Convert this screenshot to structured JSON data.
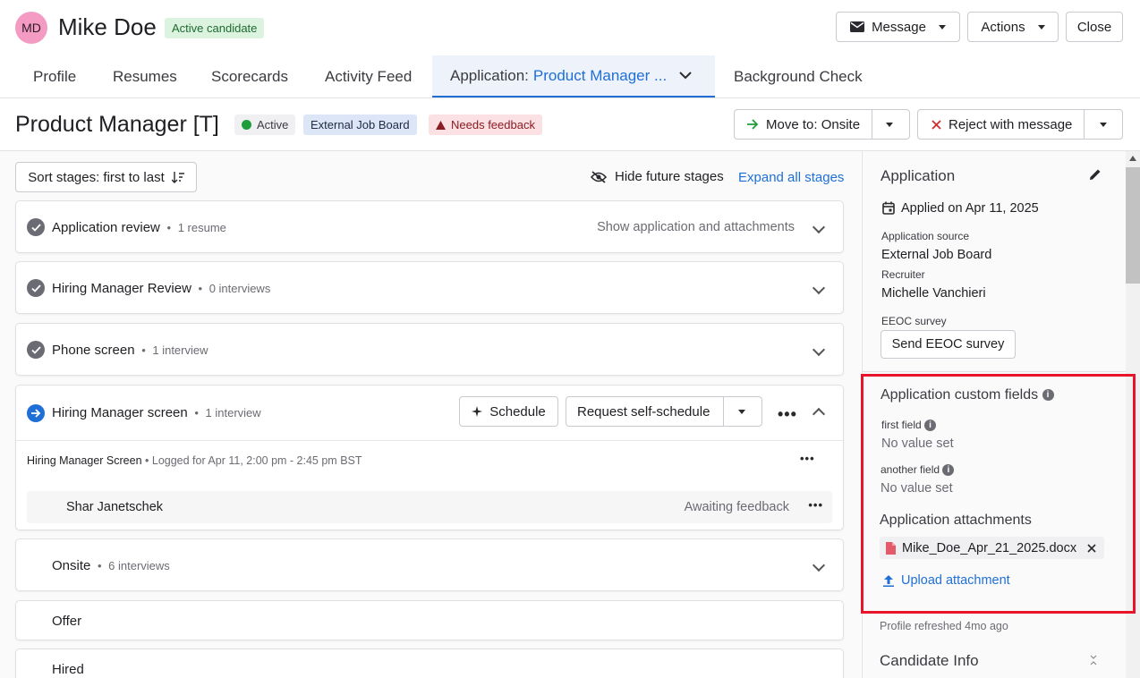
{
  "candidate": {
    "initials": "MD",
    "name": "Mike Doe",
    "status_badge": "Active candidate"
  },
  "header_actions": {
    "message_label": "Message",
    "actions_label": "Actions",
    "close_label": "Close"
  },
  "tabs": [
    {
      "label": "Profile"
    },
    {
      "label": "Resumes"
    },
    {
      "label": "Scorecards"
    },
    {
      "label": "Activity Feed"
    },
    {
      "label_prefix": "Application:",
      "label_accent": "Product Manager ..."
    },
    {
      "label": "Background Check"
    }
  ],
  "job": {
    "title": "Product Manager [T]",
    "status": "Active",
    "source_badge": "External Job Board",
    "feedback_badge": "Needs feedback",
    "move_to_label": "Move to: Onsite",
    "reject_label": "Reject with message"
  },
  "stages_toolbar": {
    "sort_label": "Sort stages: first to last",
    "hide_future_label": "Hide future stages",
    "expand_all_label": "Expand all stages"
  },
  "stages": [
    {
      "name": "Application review",
      "sub": "1 resume",
      "action": "Show application and attachments",
      "done": true
    },
    {
      "name": "Hiring Manager Review",
      "sub": "0 interviews",
      "done": true
    },
    {
      "name": "Phone screen",
      "sub": "1 interview",
      "done": true
    },
    {
      "name": "Hiring Manager screen",
      "sub": "1 interview",
      "current": true,
      "schedule_label": "Schedule",
      "self_schedule_label": "Request self-schedule",
      "detail_title": "Hiring Manager Screen",
      "detail_logged": "Logged for Apr 11, 2:00 pm - 2:45 pm BST",
      "interviewer": "Shar Janetschek",
      "interviewer_status": "Awaiting feedback"
    },
    {
      "name": "Onsite",
      "sub": "6 interviews"
    },
    {
      "name": "Offer"
    },
    {
      "name": "Hired"
    }
  ],
  "application": {
    "title": "Application",
    "applied": "Applied on Apr 11, 2025",
    "source_label": "Application source",
    "source_value": "External Job Board",
    "recruiter_label": "Recruiter",
    "recruiter_value": "Michelle Vanchieri",
    "eeoc_label": "EEOC survey",
    "eeoc_button": "Send EEOC survey",
    "custom_fields_title": "Application custom fields",
    "custom_fields": [
      {
        "label": "first field",
        "value": "No value set"
      },
      {
        "label": "another field",
        "value": "No value set"
      }
    ],
    "attachments_title": "Application attachments",
    "attachment_file": "Mike_Doe_Apr_21_2025.docx",
    "upload_label": "Upload attachment",
    "refreshed": "Profile refreshed 4mo ago",
    "candidate_info_title": "Candidate Info"
  },
  "colors": {
    "accent": "#1f6fd6",
    "highlight": "#e8152a",
    "success": "#1f9d3a"
  }
}
